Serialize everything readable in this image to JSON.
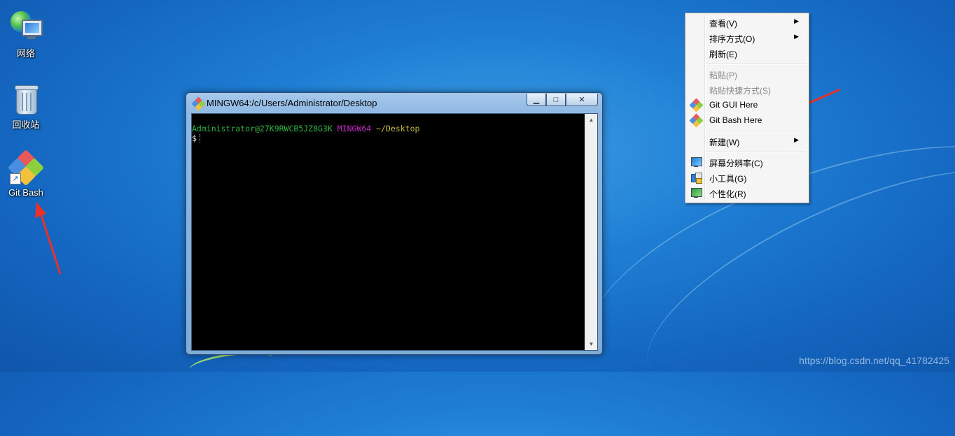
{
  "desktop": {
    "icons": [
      {
        "label": "网络",
        "icon": "network-icon"
      },
      {
        "label": "回收站",
        "icon": "recycle-bin-icon"
      },
      {
        "label": "Git Bash",
        "icon": "git-bash-icon"
      }
    ]
  },
  "terminal": {
    "title": "MINGW64:/c/Users/Administrator/Desktop",
    "user_host": "Administrator@27K9RWCB5JZ8G3K",
    "system": "MINGW64",
    "path": "~/Desktop",
    "prompt": "$",
    "colors": {
      "user": "#2fb640",
      "system": "#c62ac6",
      "path": "#c8b83b"
    },
    "caption_buttons": {
      "minimize": "▁",
      "maximize": "□",
      "close": "✕"
    }
  },
  "context_menu": {
    "items": [
      {
        "label": "查看(V)",
        "submenu": true,
        "enabled": true
      },
      {
        "label": "排序方式(O)",
        "submenu": true,
        "enabled": true
      },
      {
        "label": "刷新(E)",
        "submenu": false,
        "enabled": true
      },
      {
        "label": "粘贴(P)",
        "submenu": false,
        "enabled": false
      },
      {
        "label": "粘贴快捷方式(S)",
        "submenu": false,
        "enabled": false
      },
      {
        "label": "Git GUI Here",
        "submenu": false,
        "enabled": true,
        "icon": "git-gui-icon"
      },
      {
        "label": "Git Bash Here",
        "submenu": false,
        "enabled": true,
        "icon": "git-bash-icon"
      },
      {
        "label": "新建(W)",
        "submenu": true,
        "enabled": true
      },
      {
        "label": "屏幕分辨率(C)",
        "submenu": false,
        "enabled": true,
        "icon": "screen-resolution-icon"
      },
      {
        "label": "小工具(G)",
        "submenu": false,
        "enabled": true,
        "icon": "gadgets-icon"
      },
      {
        "label": "个性化(R)",
        "submenu": false,
        "enabled": true,
        "icon": "personalize-icon"
      }
    ],
    "submenu_arrow": "▶"
  },
  "watermark": "https://blog.csdn.net/qq_41782425",
  "accent_colors": {
    "annotation_arrow": "#e8312a",
    "desktop_blue": "#1f7fd4"
  }
}
